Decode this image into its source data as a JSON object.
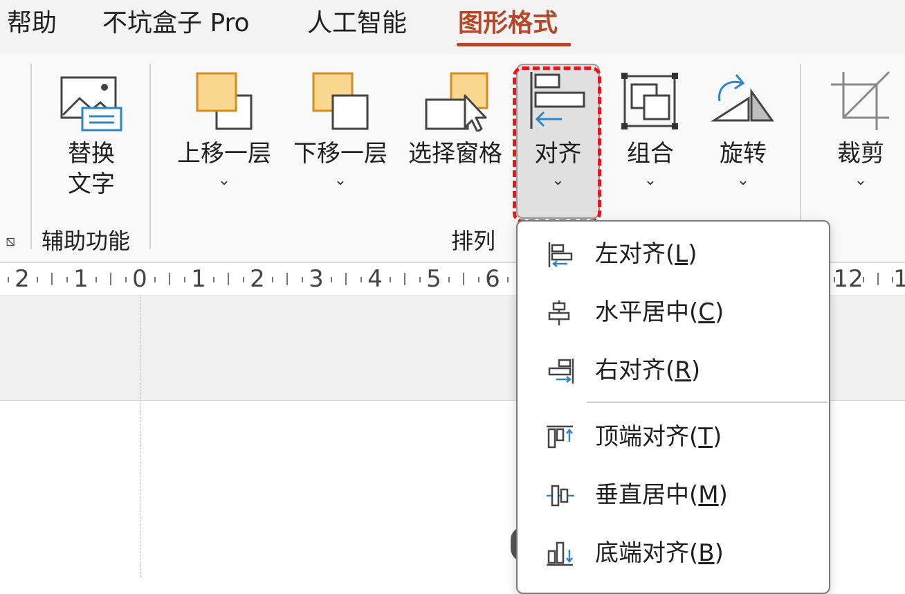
{
  "tabs": [
    {
      "label": "帮助",
      "active": false
    },
    {
      "label": "不坑盒子 Pro",
      "active": false
    },
    {
      "label": "人工智能",
      "active": false
    },
    {
      "label": "图形格式",
      "active": true
    }
  ],
  "ribbon": {
    "accessibility": {
      "replace_text": {
        "line1": "替换",
        "line2": "文字",
        "icon": "alt-text-icon"
      },
      "group_label": "辅助功能"
    },
    "arrange": {
      "bring_forward": {
        "label": "上移一层",
        "chevron": "⌄",
        "icon": "bring-forward-icon"
      },
      "send_backward": {
        "label": "下移一层",
        "chevron": "⌄",
        "icon": "send-backward-icon"
      },
      "selection_pane": {
        "label": "选择窗格",
        "icon": "selection-pane-icon"
      },
      "align": {
        "label": "对齐",
        "chevron": "⌄",
        "icon": "align-icon"
      },
      "group": {
        "label": "组合",
        "chevron": "⌄",
        "icon": "group-objects-icon"
      },
      "rotate": {
        "label": "旋转",
        "chevron": "⌄",
        "icon": "rotate-icon"
      },
      "group_label": "排列"
    },
    "size": {
      "crop": {
        "label": "裁剪",
        "chevron": "⌄",
        "icon": "crop-icon"
      }
    },
    "launcher": "⧅"
  },
  "ruler": {
    "labels": [
      "2",
      "1",
      "0",
      "1",
      "2",
      "3",
      "4",
      "5",
      "6",
      "12",
      "1"
    ]
  },
  "align_menu": {
    "items": [
      {
        "text": "左对齐(",
        "key": "L",
        "tail": ")",
        "icon": "align-left-icon"
      },
      {
        "text": "水平居中(",
        "key": "C",
        "tail": ")",
        "icon": "align-center-icon"
      },
      {
        "text": "右对齐(",
        "key": "R",
        "tail": ")",
        "icon": "align-right-icon"
      },
      {
        "text": "顶端对齐(",
        "key": "T",
        "tail": ")",
        "icon": "align-top-icon"
      },
      {
        "text": "垂直居中(",
        "key": "M",
        "tail": ")",
        "icon": "align-middle-icon"
      },
      {
        "text": "底端对齐(",
        "key": "B",
        "tail": ")",
        "icon": "align-bottom-icon"
      }
    ]
  },
  "colors": {
    "accent": "#b7472a",
    "highlight_border": "#e8151b",
    "shape_fill": "#f9d78e",
    "shape_stroke": "#d98a1f",
    "icon_blue": "#2e86c8"
  }
}
